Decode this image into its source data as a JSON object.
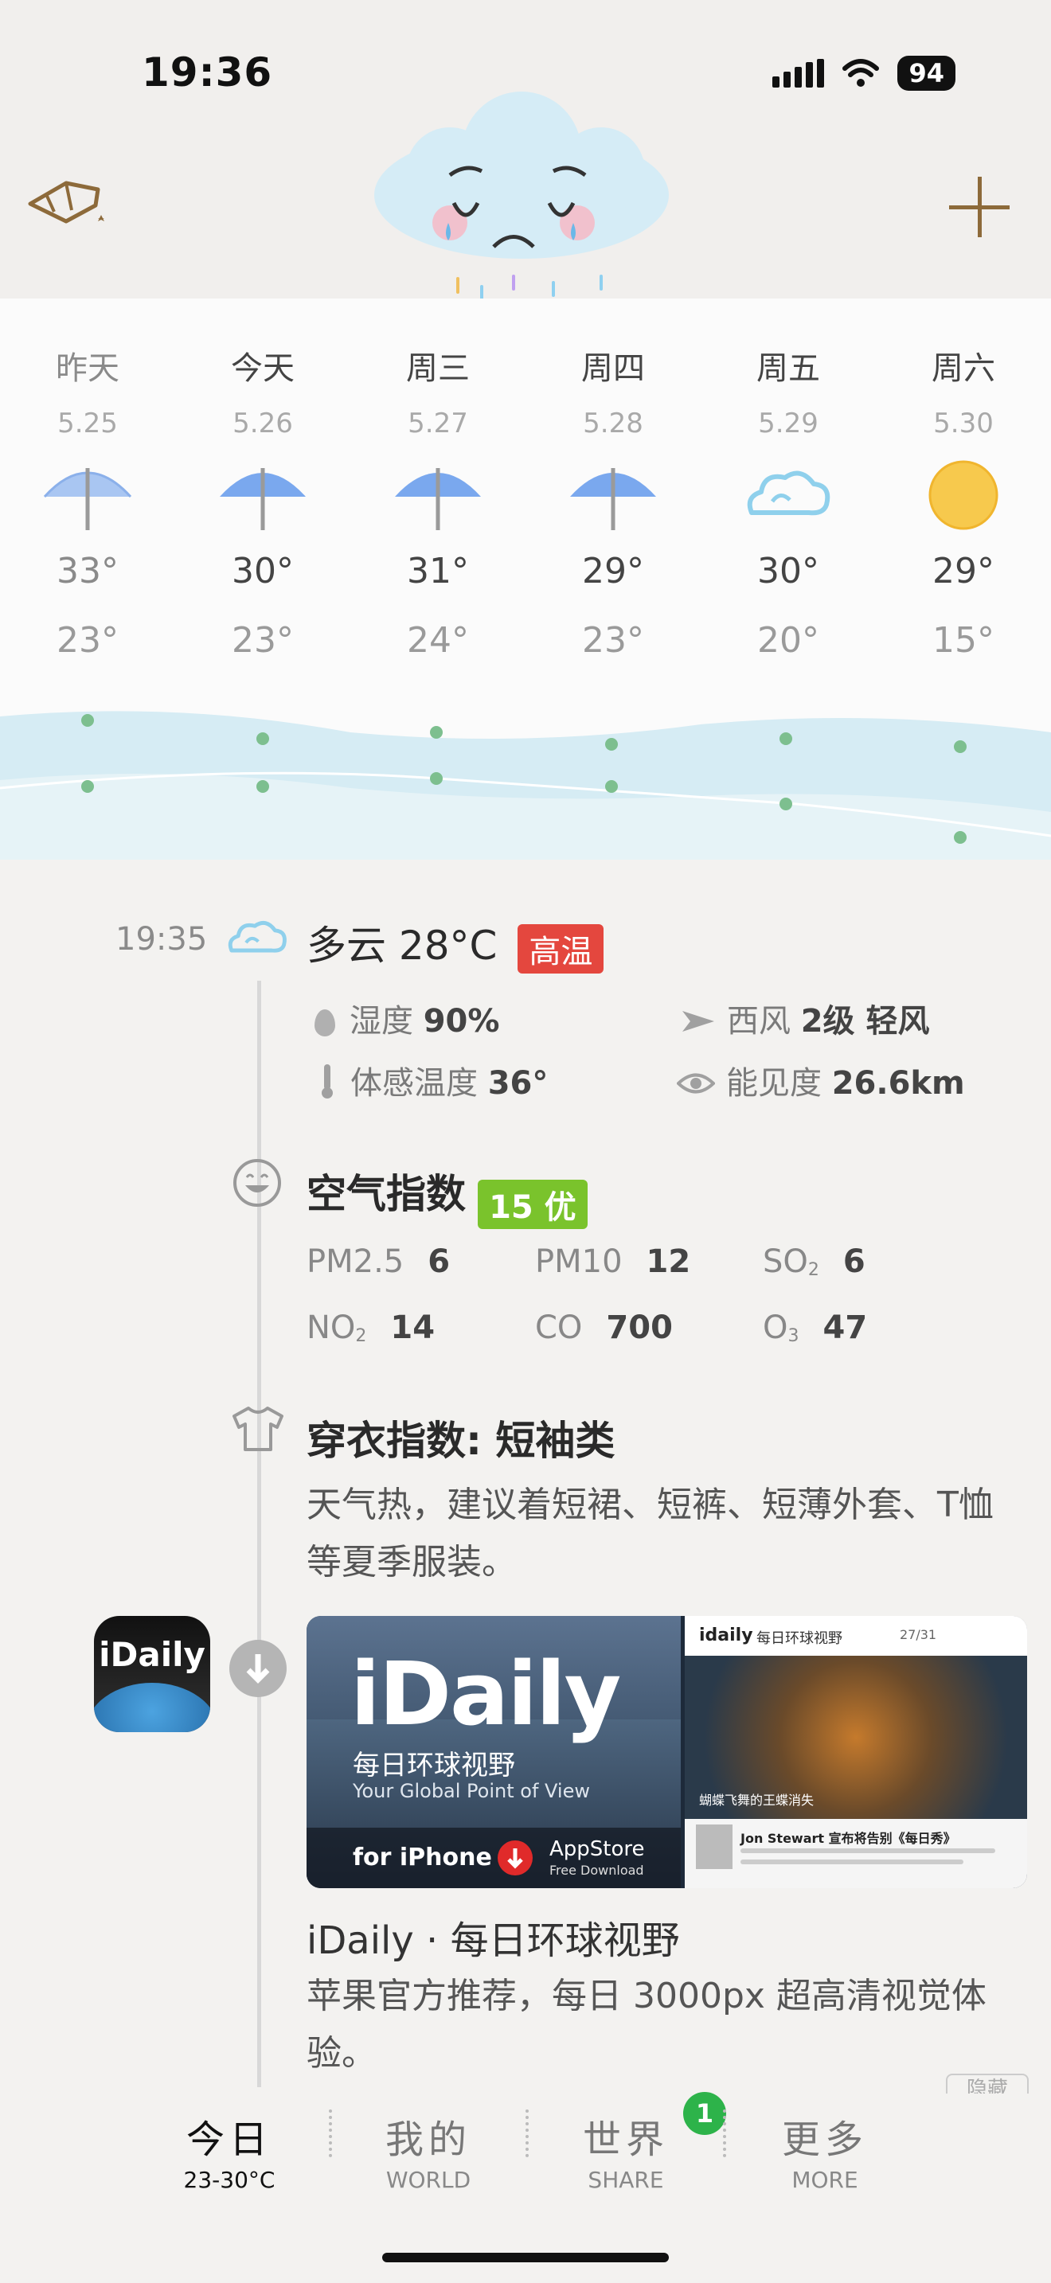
{
  "status": {
    "time": "19:36",
    "battery": "94"
  },
  "forecast": [
    {
      "day": "昨天",
      "date": "5.25",
      "icon": "umbrella-icon",
      "high": "33°",
      "low": "23°"
    },
    {
      "day": "今天",
      "date": "5.26",
      "icon": "umbrella-icon",
      "high": "30°",
      "low": "23°"
    },
    {
      "day": "周三",
      "date": "5.27",
      "icon": "umbrella-icon",
      "high": "31°",
      "low": "24°"
    },
    {
      "day": "周四",
      "date": "5.28",
      "icon": "umbrella-icon",
      "high": "29°",
      "low": "23°"
    },
    {
      "day": "周五",
      "date": "5.29",
      "icon": "cloud-icon",
      "high": "30°",
      "low": "20°"
    },
    {
      "day": "周六",
      "date": "5.30",
      "icon": "sun-icon",
      "high": "29°",
      "low": "15°"
    }
  ],
  "current": {
    "time": "19:35",
    "condition": "多云 28°C",
    "badge": "高温",
    "humidity_label": "湿度",
    "humidity_value": "90%",
    "wind_label": "西风",
    "wind_value": "2级 轻风",
    "feels_label": "体感温度",
    "feels_value": "36°",
    "visibility_label": "能见度",
    "visibility_value": "26.6km"
  },
  "air": {
    "title": "空气指数",
    "badge": "15 优",
    "items": [
      {
        "label": "PM2.5",
        "sub": "",
        "value": "6"
      },
      {
        "label": "PM10",
        "sub": "",
        "value": "12"
      },
      {
        "label": "SO",
        "sub": "2",
        "value": "6"
      },
      {
        "label": "NO",
        "sub": "2",
        "value": "14"
      },
      {
        "label": "CO",
        "sub": "",
        "value": "700"
      },
      {
        "label": "O",
        "sub": "3",
        "value": "47"
      }
    ]
  },
  "clothing": {
    "title": "穿衣指数: 短袖类",
    "text": "天气热，建议着短裙、短裤、短薄外套、T恤等夏季服装。"
  },
  "ad": {
    "app_icon_text": "iDaily",
    "banner_title": "iDaily",
    "banner_subtitle": "每日环球视野",
    "banner_tagline": "Your Global Point of View",
    "banner_platform": "for iPhone",
    "banner_store": "AppStore",
    "banner_store_sub": "Free Download",
    "screen_brand": "idaily",
    "screen_header": "每日环球视野",
    "screen_page": "27/31",
    "screen_caption": "蝴蝶飞舞的王蝶消失",
    "screen_news": "Jon Stewart 宣布将告别《每日秀》",
    "title": "iDaily · 每日环球视野",
    "desc": "苹果官方推荐，每日 3000px 超高清视觉体验。",
    "hide_label": "隐藏"
  },
  "nav": [
    {
      "label": "今日",
      "sub": "23-30°C",
      "active": true
    },
    {
      "label": "我的",
      "sub": "WORLD"
    },
    {
      "label": "世界",
      "sub": "SHARE",
      "badge": "1"
    },
    {
      "label": "更多",
      "sub": "MORE"
    }
  ],
  "colors": {
    "hot_badge": "#e4473e",
    "aqi_badge": "#7ac32c",
    "notif": "#2db34a",
    "accent": "#8d6a3a"
  }
}
